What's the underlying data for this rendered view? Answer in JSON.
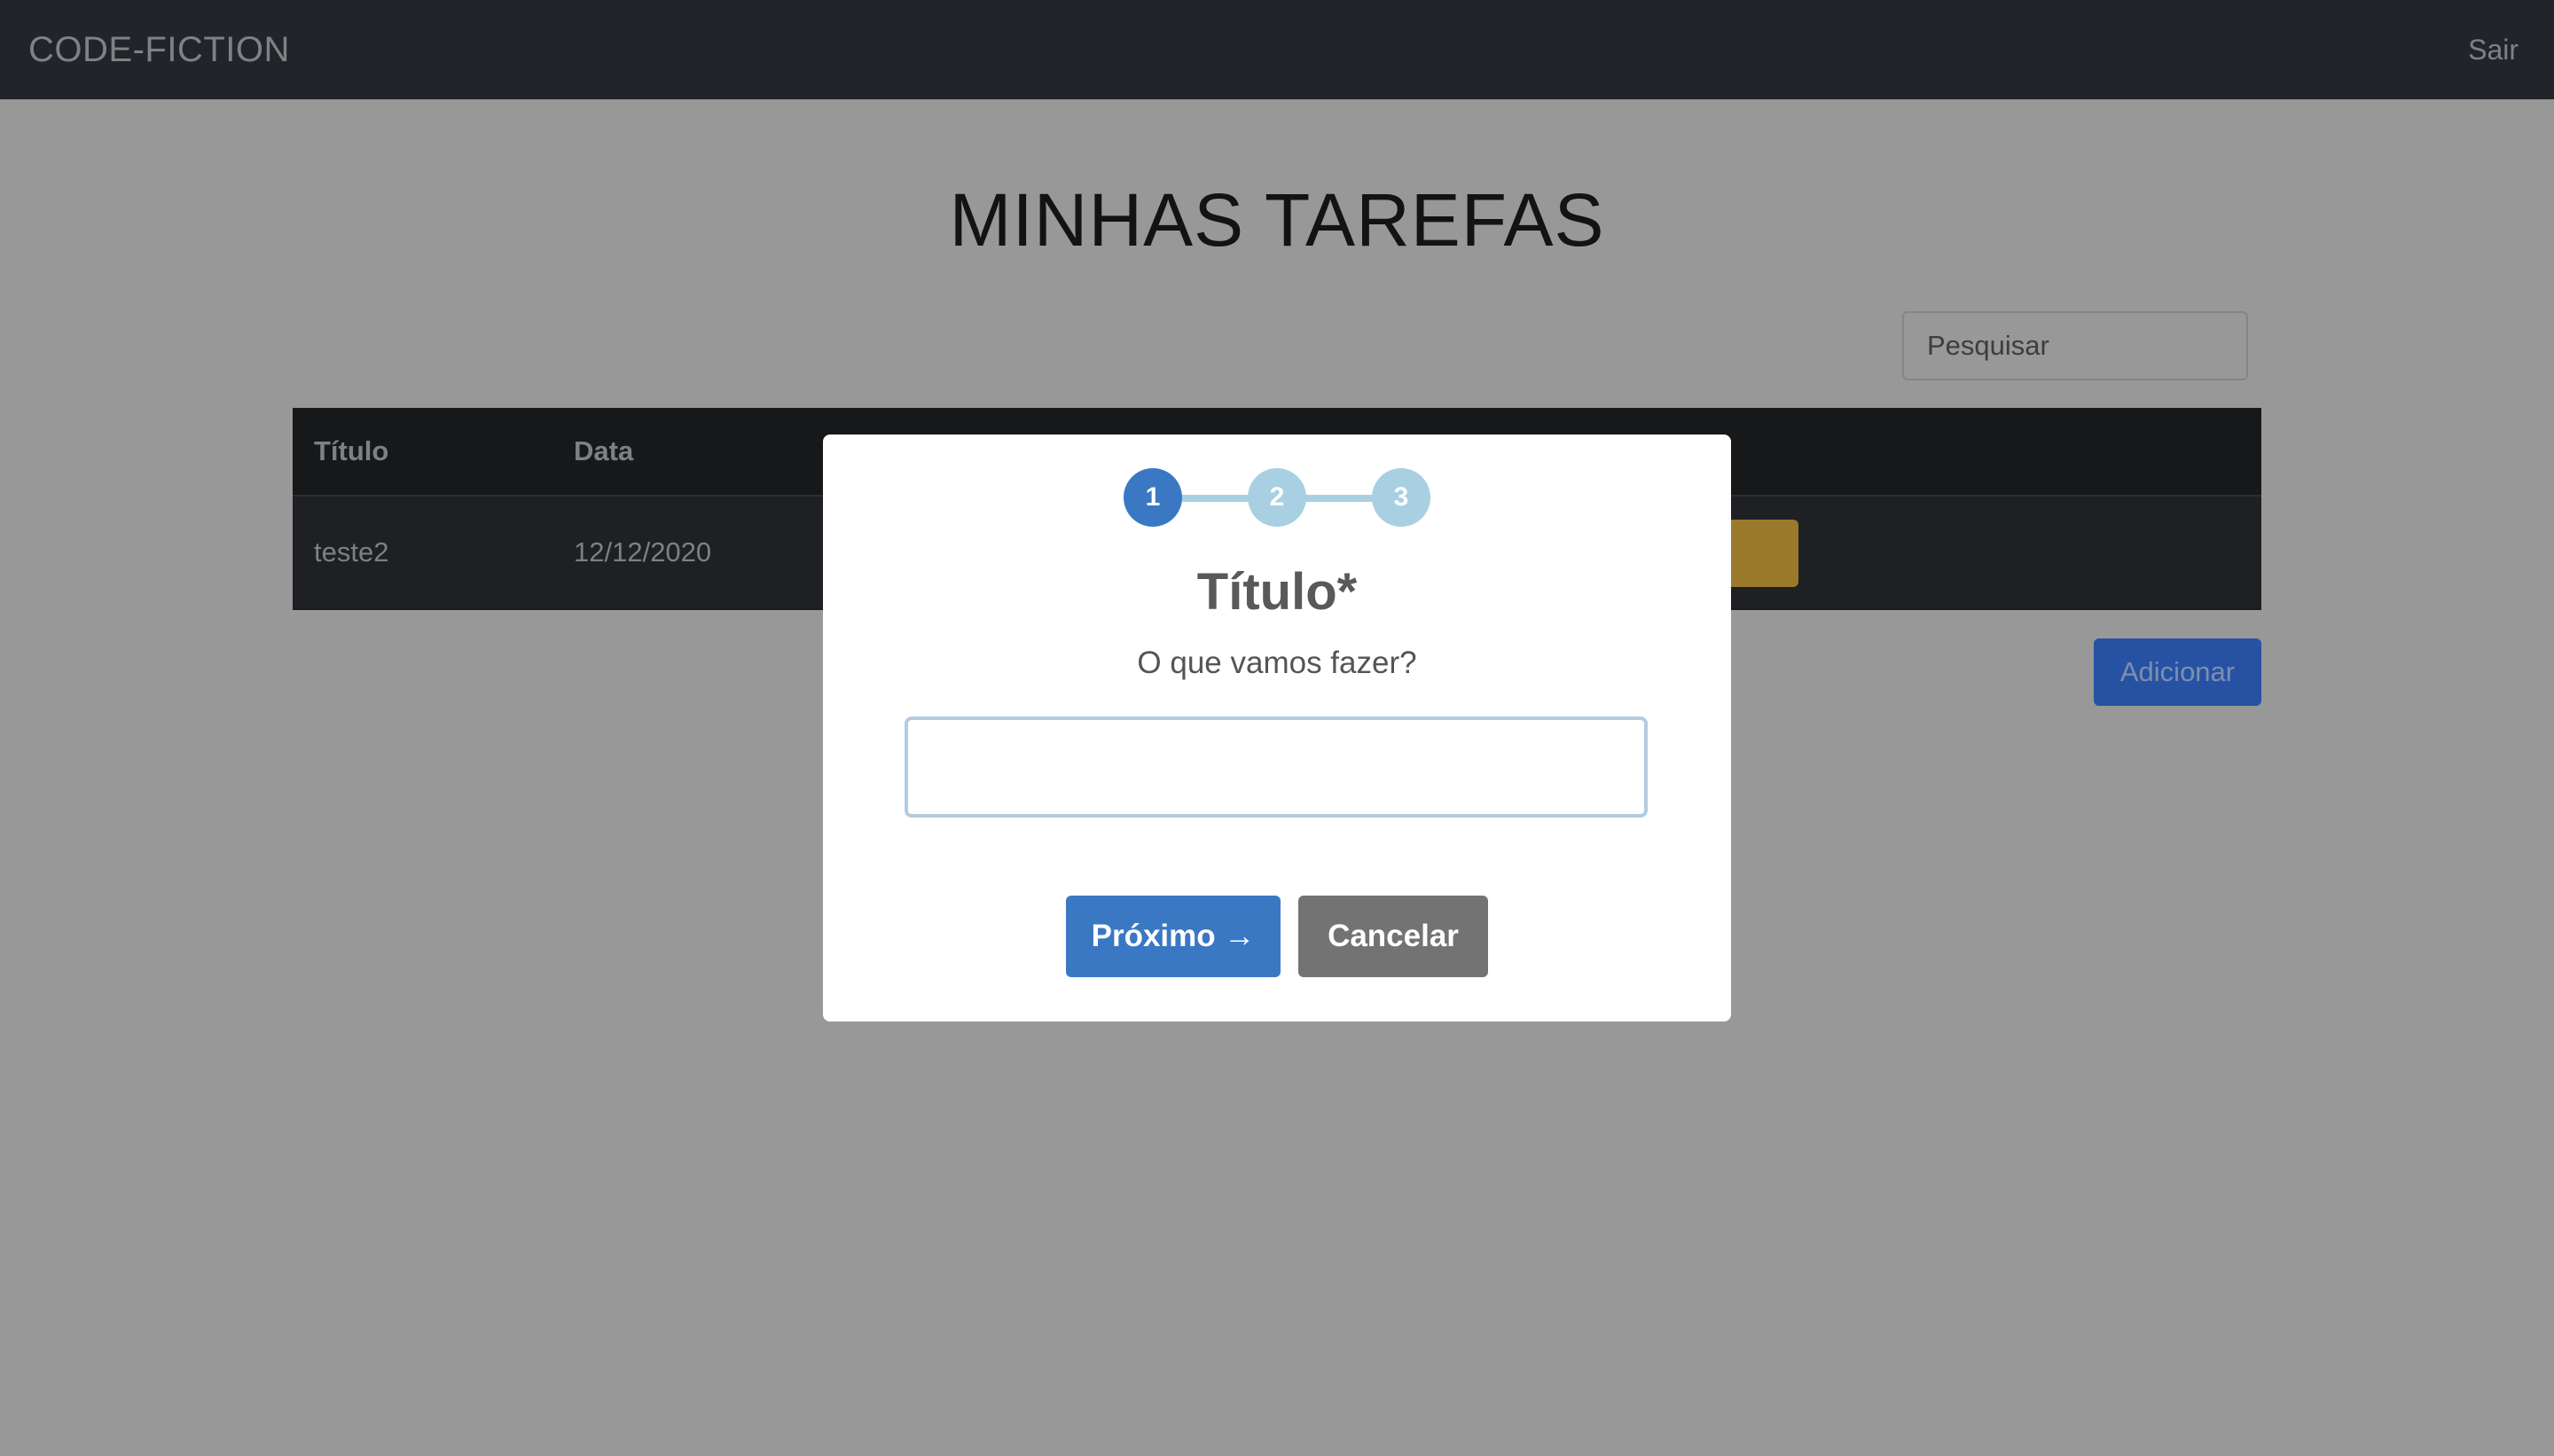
{
  "navbar": {
    "brand": "CODE-FICTION",
    "logout_label": "Sair"
  },
  "page": {
    "title": "MINHAS TAREFAS"
  },
  "search": {
    "placeholder": "Pesquisar",
    "value": ""
  },
  "table": {
    "columns": [
      "Título",
      "Data"
    ],
    "rows": [
      {
        "title": "teste2",
        "date": "12/12/2020"
      }
    ]
  },
  "actions": {
    "add_label": "Adicionar"
  },
  "modal": {
    "steps": [
      "1",
      "2",
      "3"
    ],
    "current_step": 1,
    "title": "Título*",
    "subtitle": "O que vamos fazer?",
    "input_value": "",
    "next_label": "Próximo →",
    "cancel_label": "Cancelar"
  },
  "colors": {
    "navbar_bg": "#212529",
    "backdrop": "#989898",
    "primary": "#3a78c3",
    "step_inactive": "#a8d0e2",
    "cancel": "#737373",
    "warning_dimmed": "#9a7a2a",
    "add_button_dimmed": "#2752a3"
  }
}
